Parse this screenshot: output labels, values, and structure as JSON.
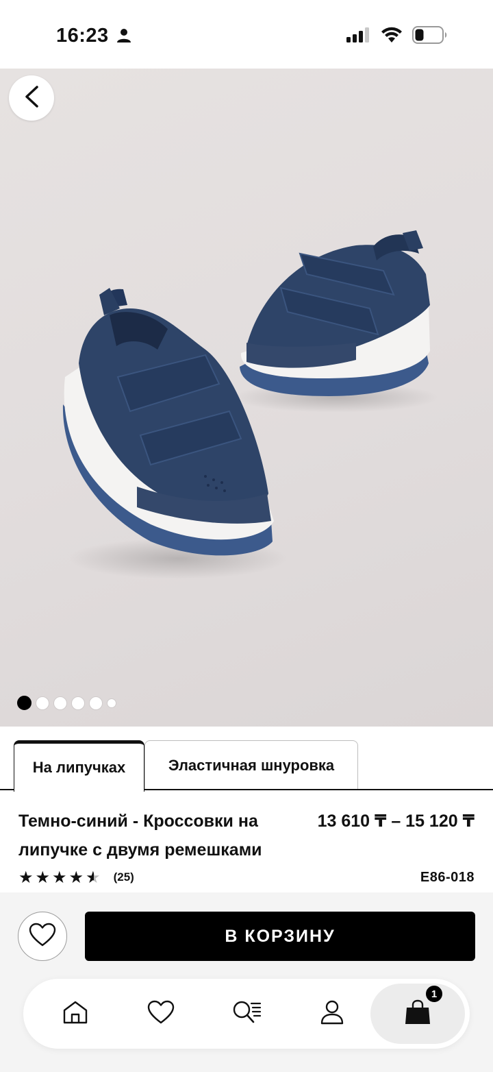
{
  "status_bar": {
    "time": "16:23",
    "icons": [
      "person-icon",
      "signal-icon",
      "wifi-icon",
      "battery-icon"
    ]
  },
  "gallery": {
    "image_description": "navy-velcro-sneakers-photo",
    "total_images": 6,
    "current_index": 0
  },
  "variants": {
    "tabs": [
      {
        "label": "На липучках",
        "active": true
      },
      {
        "label": "Эластичная шнуровка",
        "active": false
      }
    ]
  },
  "product": {
    "title": "Темно-синий - Кроссовки на липучке с двумя ремешками",
    "price": "13 610 ₸ – 15 120 ₸",
    "rating_value": 4.5,
    "rating_count": "(25)",
    "sku": "E86-018"
  },
  "actions": {
    "add_to_cart": "В КОРЗИНУ",
    "favorite_icon": "heart-icon"
  },
  "tabbar": {
    "items": [
      "home-icon",
      "heart-icon",
      "search-list-icon",
      "account-icon",
      "shopping-bag-icon"
    ],
    "bag_count": "1"
  },
  "colors": {
    "accent": "#000000",
    "shoe_navy": "#2e4468",
    "background_hero": "#e3dfde"
  }
}
